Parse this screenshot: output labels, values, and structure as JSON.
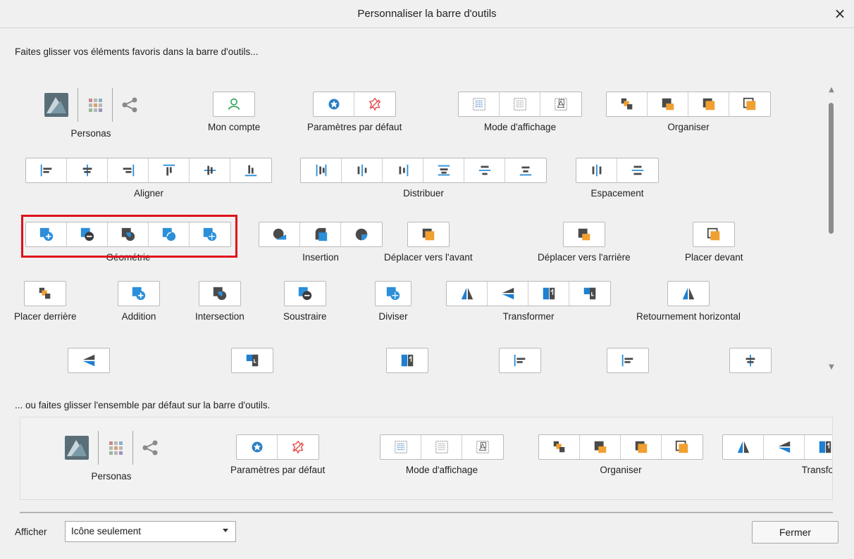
{
  "dialog": {
    "title": "Personnaliser la barre d'outils",
    "close": "×"
  },
  "intro_text": "Faites glisser vos éléments favoris dans la barre d'outils...",
  "default_text": "... ou faites glisser l'ensemble par défaut sur la barre d'outils.",
  "items": {
    "personas": "Personas",
    "mon_compte": "Mon compte",
    "parametres": "Paramètres par défaut",
    "mode_affichage": "Mode d'affichage",
    "organiser": "Organiser",
    "aligner": "Aligner",
    "distribuer": "Distribuer",
    "espacement": "Espacement",
    "geometrie": "Géométrie",
    "insertion": "Insertion",
    "deplacer_avant": "Déplacer vers l'avant",
    "deplacer_arriere": "Déplacer vers l'arrière",
    "placer_devant": "Placer devant",
    "placer_derriere": "Placer derrière",
    "addition": "Addition",
    "intersection": "Intersection",
    "soustraire": "Soustraire",
    "diviser": "Diviser",
    "transformer": "Transformer",
    "retournement": "Retournement horizontal"
  },
  "default_set": {
    "personas": "Personas",
    "parametres": "Paramètres par défaut",
    "mode_affichage": "Mode d'affichage",
    "organiser": "Organiser",
    "transformer_cut": "Transfo"
  },
  "footer": {
    "afficher": "Afficher",
    "select_value": "Icône seulement",
    "close_button": "Fermer"
  },
  "colors": {
    "blue": "#2b8fd9",
    "dark": "#4a4a4a",
    "orange": "#f0a030",
    "gray": "#8a8a8a",
    "highlight": "#e0101c"
  },
  "scroll": {
    "up": "▲",
    "down": "▼"
  }
}
